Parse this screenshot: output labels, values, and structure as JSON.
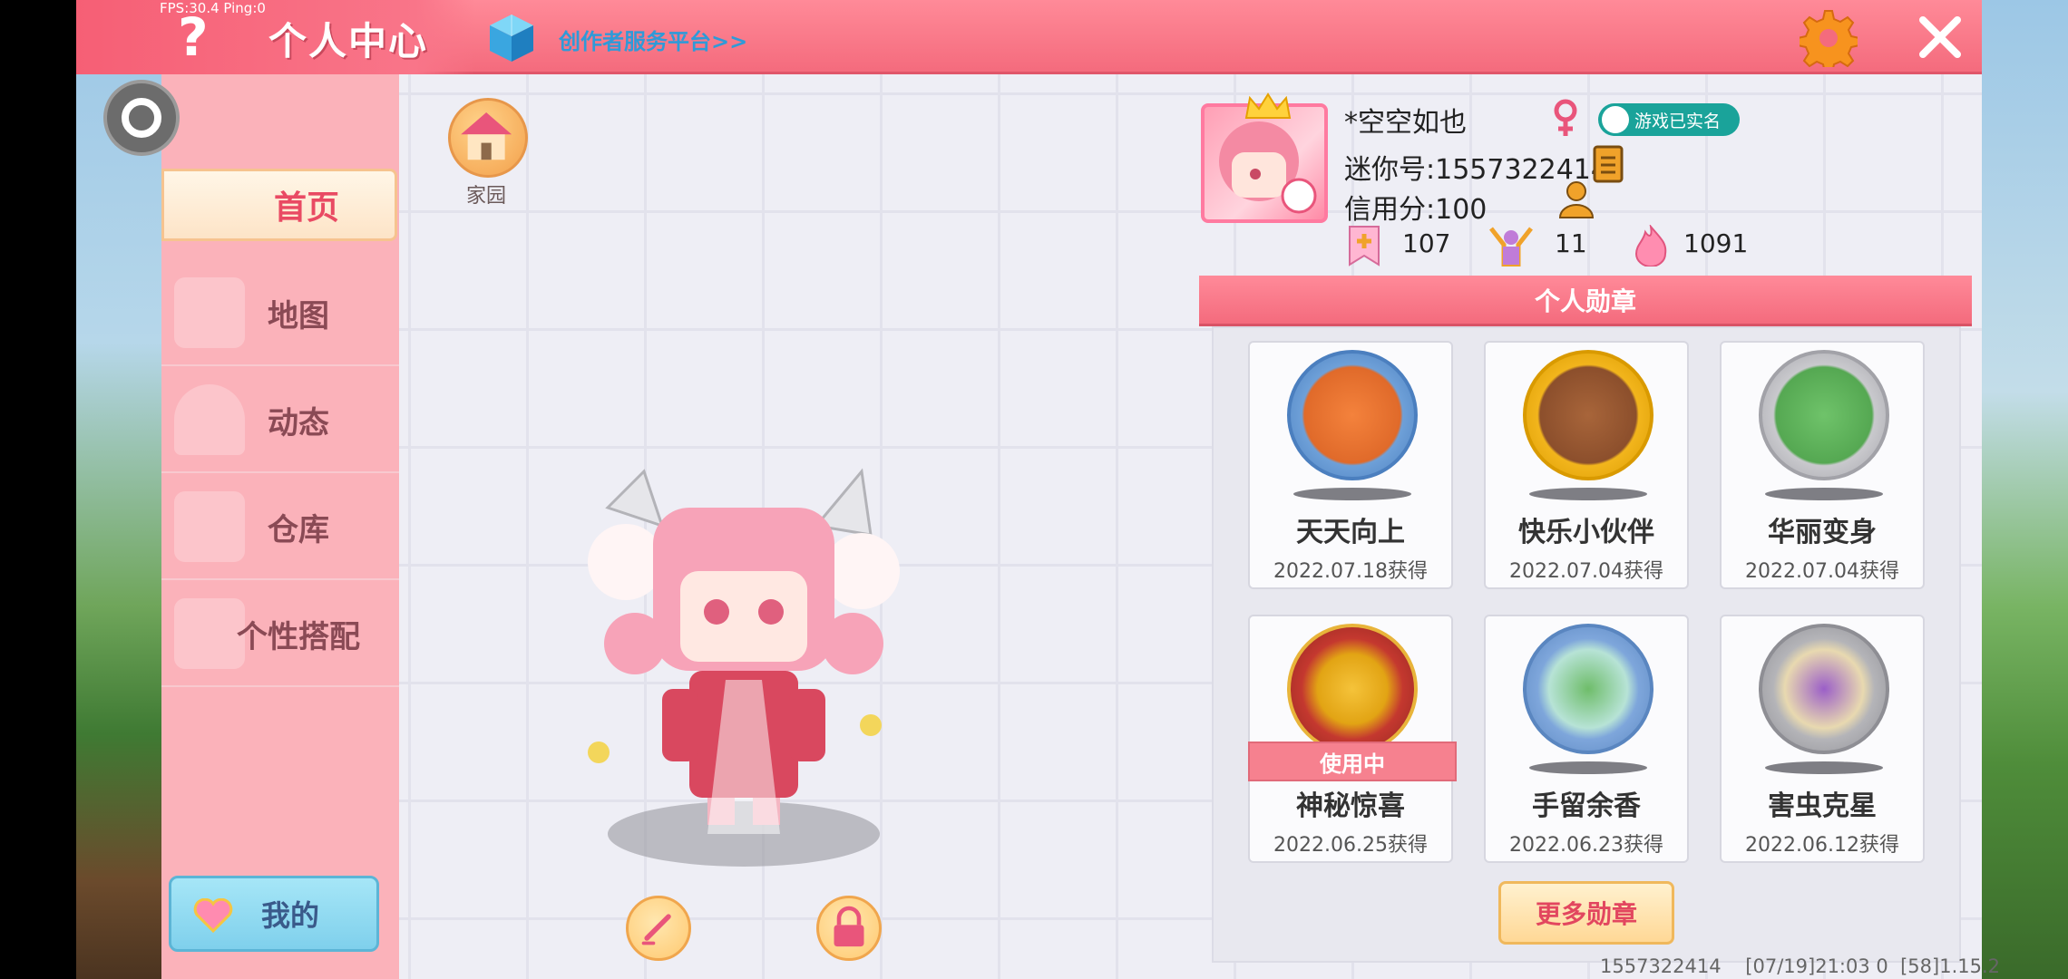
{
  "status_overlay": "FPS:30.4  Ping:0",
  "header": {
    "title": "个人中心",
    "creator_link": "创作者服务平台>>",
    "help_icon": "question-mark",
    "settings_icon": "gear-icon",
    "close_icon": "close-icon",
    "accent_color": "#f46b7d"
  },
  "sidebar": {
    "items": [
      {
        "label": "首页",
        "active": true
      },
      {
        "label": "地图",
        "active": false
      },
      {
        "label": "动态",
        "active": false
      },
      {
        "label": "仓库",
        "active": false
      },
      {
        "label": "个性搭配",
        "active": false
      }
    ],
    "my_button": "我的"
  },
  "home": {
    "label": "家园"
  },
  "profile": {
    "nickname": "*空空如也",
    "gender": "female",
    "verified_badge": "游戏已实名",
    "mini_id": "迷你号:1557322414",
    "credit": "信用分:100",
    "stats": [
      {
        "icon": "bookmark-plus-icon",
        "value": "107"
      },
      {
        "icon": "cheer-person-icon",
        "value": "11"
      },
      {
        "icon": "flame-icon",
        "value": "1091"
      }
    ]
  },
  "medals": {
    "title": "个人勋章",
    "items": [
      {
        "name": "天天向上",
        "date": "2022.07.18获得",
        "color": "#6ea0d8",
        "in_use": false
      },
      {
        "name": "快乐小伙伴",
        "date": "2022.07.04获得",
        "color": "#f2b51c",
        "in_use": false
      },
      {
        "name": "华丽变身",
        "date": "2022.07.04获得",
        "color": "#b9b9bd",
        "in_use": false
      },
      {
        "name": "神秘惊喜",
        "date": "2022.06.25获得",
        "color": "#e8b43a",
        "in_use": true
      },
      {
        "name": "手留余香",
        "date": "2022.06.23获得",
        "color": "#7ea6db",
        "in_use": false
      },
      {
        "name": "害虫克星",
        "date": "2022.06.12获得",
        "color": "#b4b4b8",
        "in_use": false
      }
    ],
    "in_use_label": "使用中",
    "more_button": "更多勋章"
  },
  "footer": "1557322414    [07/19]21:03 0  [58]1.15.2"
}
